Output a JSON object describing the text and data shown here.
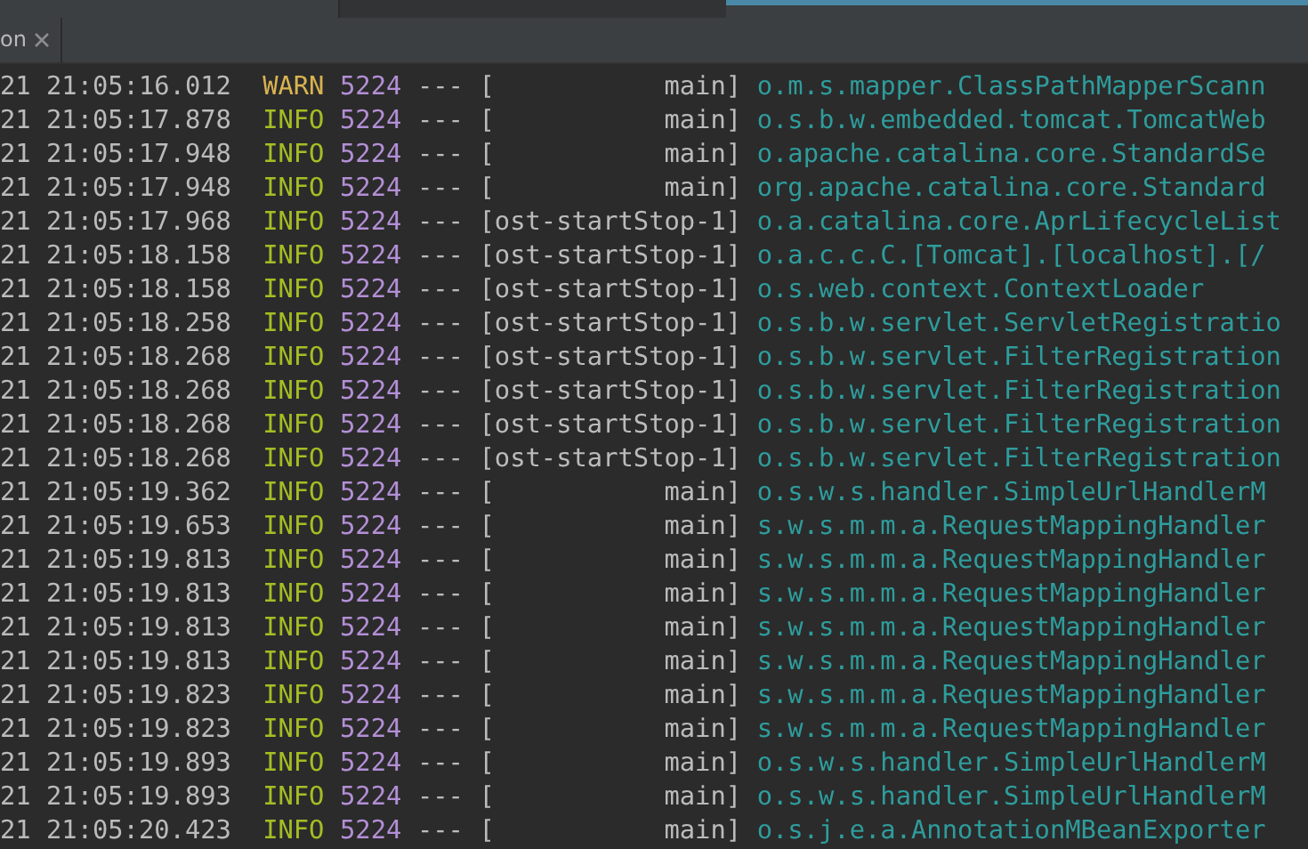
{
  "tab": {
    "label": "on"
  },
  "log_lines": [
    {
      "time": "21 21:05:16.012",
      "level": "WARN",
      "pid": "5224",
      "sep": "---",
      "thread": "[            main]",
      "logger": "o.m.s.mapper.ClassPathMapperScann"
    },
    {
      "time": "21 21:05:17.878",
      "level": "INFO",
      "pid": "5224",
      "sep": "---",
      "thread": "[            main]",
      "logger": "o.s.b.w.embedded.tomcat.TomcatWeb"
    },
    {
      "time": "21 21:05:17.948",
      "level": "INFO",
      "pid": "5224",
      "sep": "---",
      "thread": "[            main]",
      "logger": "o.apache.catalina.core.StandardSe"
    },
    {
      "time": "21 21:05:17.948",
      "level": "INFO",
      "pid": "5224",
      "sep": "---",
      "thread": "[            main]",
      "logger": "org.apache.catalina.core.Standard"
    },
    {
      "time": "21 21:05:17.968",
      "level": "INFO",
      "pid": "5224",
      "sep": "---",
      "thread": "[ost-startStop-1]",
      "logger": "o.a.catalina.core.AprLifecycleList"
    },
    {
      "time": "21 21:05:18.158",
      "level": "INFO",
      "pid": "5224",
      "sep": "---",
      "thread": "[ost-startStop-1]",
      "logger": "o.a.c.c.C.[Tomcat].[localhost].[/"
    },
    {
      "time": "21 21:05:18.158",
      "level": "INFO",
      "pid": "5224",
      "sep": "---",
      "thread": "[ost-startStop-1]",
      "logger": "o.s.web.context.ContextLoader"
    },
    {
      "time": "21 21:05:18.258",
      "level": "INFO",
      "pid": "5224",
      "sep": "---",
      "thread": "[ost-startStop-1]",
      "logger": "o.s.b.w.servlet.ServletRegistratio"
    },
    {
      "time": "21 21:05:18.268",
      "level": "INFO",
      "pid": "5224",
      "sep": "---",
      "thread": "[ost-startStop-1]",
      "logger": "o.s.b.w.servlet.FilterRegistration"
    },
    {
      "time": "21 21:05:18.268",
      "level": "INFO",
      "pid": "5224",
      "sep": "---",
      "thread": "[ost-startStop-1]",
      "logger": "o.s.b.w.servlet.FilterRegistration"
    },
    {
      "time": "21 21:05:18.268",
      "level": "INFO",
      "pid": "5224",
      "sep": "---",
      "thread": "[ost-startStop-1]",
      "logger": "o.s.b.w.servlet.FilterRegistration"
    },
    {
      "time": "21 21:05:18.268",
      "level": "INFO",
      "pid": "5224",
      "sep": "---",
      "thread": "[ost-startStop-1]",
      "logger": "o.s.b.w.servlet.FilterRegistration"
    },
    {
      "time": "21 21:05:19.362",
      "level": "INFO",
      "pid": "5224",
      "sep": "---",
      "thread": "[            main]",
      "logger": "o.s.w.s.handler.SimpleUrlHandlerM"
    },
    {
      "time": "21 21:05:19.653",
      "level": "INFO",
      "pid": "5224",
      "sep": "---",
      "thread": "[            main]",
      "logger": "s.w.s.m.m.a.RequestMappingHandler"
    },
    {
      "time": "21 21:05:19.813",
      "level": "INFO",
      "pid": "5224",
      "sep": "---",
      "thread": "[            main]",
      "logger": "s.w.s.m.m.a.RequestMappingHandler"
    },
    {
      "time": "21 21:05:19.813",
      "level": "INFO",
      "pid": "5224",
      "sep": "---",
      "thread": "[            main]",
      "logger": "s.w.s.m.m.a.RequestMappingHandler"
    },
    {
      "time": "21 21:05:19.813",
      "level": "INFO",
      "pid": "5224",
      "sep": "---",
      "thread": "[            main]",
      "logger": "s.w.s.m.m.a.RequestMappingHandler"
    },
    {
      "time": "21 21:05:19.813",
      "level": "INFO",
      "pid": "5224",
      "sep": "---",
      "thread": "[            main]",
      "logger": "s.w.s.m.m.a.RequestMappingHandler"
    },
    {
      "time": "21 21:05:19.823",
      "level": "INFO",
      "pid": "5224",
      "sep": "---",
      "thread": "[            main]",
      "logger": "s.w.s.m.m.a.RequestMappingHandler"
    },
    {
      "time": "21 21:05:19.823",
      "level": "INFO",
      "pid": "5224",
      "sep": "---",
      "thread": "[            main]",
      "logger": "s.w.s.m.m.a.RequestMappingHandler"
    },
    {
      "time": "21 21:05:19.893",
      "level": "INFO",
      "pid": "5224",
      "sep": "---",
      "thread": "[            main]",
      "logger": "o.s.w.s.handler.SimpleUrlHandlerM"
    },
    {
      "time": "21 21:05:19.893",
      "level": "INFO",
      "pid": "5224",
      "sep": "---",
      "thread": "[            main]",
      "logger": "o.s.w.s.handler.SimpleUrlHandlerM"
    },
    {
      "time": "21 21:05:20.423",
      "level": "INFO",
      "pid": "5224",
      "sep": "---",
      "thread": "[            main]",
      "logger": "o.s.j.e.a.AnnotationMBeanExporter"
    }
  ]
}
